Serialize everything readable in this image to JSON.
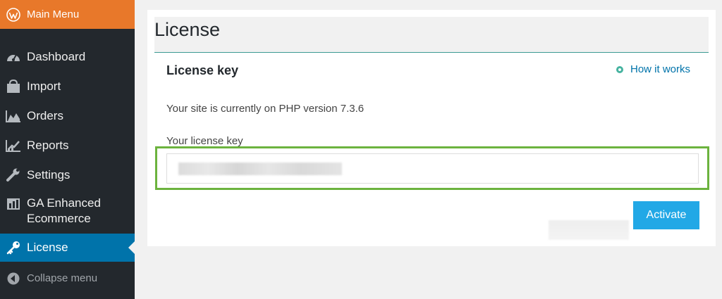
{
  "sidebar": {
    "main_menu": {
      "label": "Main Menu",
      "icon": "wordpress-icon"
    },
    "items": [
      {
        "label": "Dashboard",
        "icon": "dashboard-icon"
      },
      {
        "label": "Import",
        "icon": "cart-icon"
      },
      {
        "label": "Orders",
        "icon": "area-chart-icon"
      },
      {
        "label": "Reports",
        "icon": "line-chart-icon"
      },
      {
        "label": "Settings",
        "icon": "wrench-icon"
      },
      {
        "label": "GA Enhanced Ecommerce",
        "line1": "GA Enhanced",
        "line2": "Ecommerce",
        "icon": "ga-icon"
      },
      {
        "label": "License",
        "icon": "key-icon",
        "active": true
      },
      {
        "label": "Collapse menu",
        "icon": "collapse-icon"
      }
    ]
  },
  "page": {
    "title": "License",
    "section_title": "License key",
    "how_link": "How it works",
    "php_notice": "Your site is currently on PHP version 7.3.6",
    "key_label": "Your license key",
    "activate_label": "Activate"
  },
  "colors": {
    "sidebar_bg": "#23282d",
    "main_menu_bg": "#e8782a",
    "active_bg": "#0073aa",
    "button_bg": "#22a8e6",
    "highlight_border": "#6cb33e"
  }
}
